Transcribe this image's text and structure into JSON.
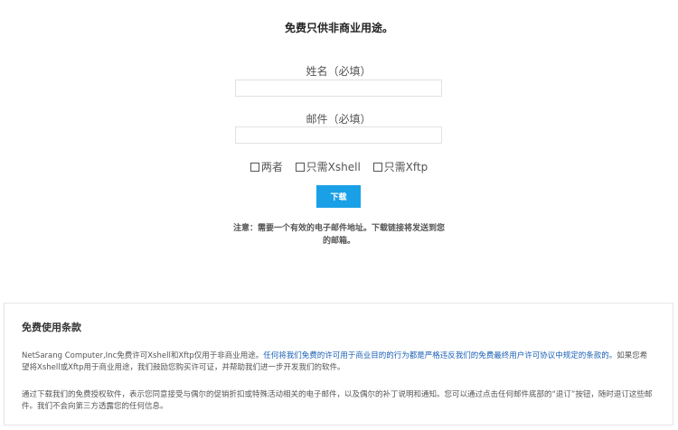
{
  "form": {
    "title": "免费只供非商业用途。",
    "name_label": "姓名（必填）",
    "name_value": "",
    "email_label": "邮件（必填）",
    "email_value": "",
    "options": [
      {
        "label": "两者",
        "checked": false
      },
      {
        "label": "只需Xshell",
        "checked": false
      },
      {
        "label": "只需Xftp",
        "checked": false
      }
    ],
    "download_label": "下载",
    "note": "注意：需要一个有效的电子邮件地址。下载链接将发送到您的邮箱。"
  },
  "terms": {
    "title": "免费使用条款",
    "p1_start": "NetSarang Computer,Inc免费许可Xshell和Xftp仅用于非商业用途。",
    "p1_link": "任何将我们免费的许可用于商业目的的行为都是严格违反我们的免费最终用户许可协议中规定的条款的。",
    "p1_end": "如果您希望将Xshell或Xftp用于商业用途，我们鼓励您购买许可证，并帮助我们进一步开发我们的软件。",
    "p2": "通过下载我们的免费授权软件，表示您同意接受与偶尔的促销折扣或特殊活动相关的电子邮件，以及偶尔的补丁说明和通知。您可以通过点击任何邮件底部的“退订”按钮，随时退订这些邮件。我们不会向第三方透露您的任何信息。"
  },
  "colors": {
    "button": "#1aa0e6",
    "link": "#1a5fb4"
  }
}
